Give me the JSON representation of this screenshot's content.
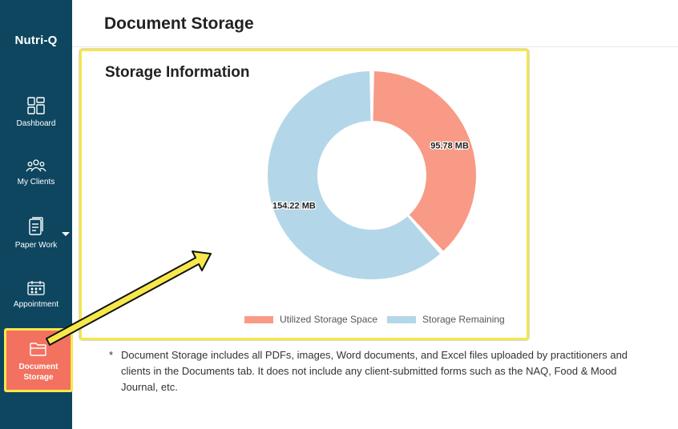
{
  "app": {
    "brand": "Nutri-Q"
  },
  "sidebar": {
    "items": [
      {
        "label": "Dashboard",
        "icon": "dashboard-icon"
      },
      {
        "label": "My Clients",
        "icon": "clients-icon"
      },
      {
        "label": "Paper Work",
        "icon": "paperwork-icon"
      },
      {
        "label": "Appointment",
        "icon": "calendar-icon"
      },
      {
        "label_line1": "Document",
        "label_line2": "Storage",
        "icon": "folder-icon",
        "active": true
      }
    ]
  },
  "page": {
    "title": "Document Storage"
  },
  "card": {
    "title": "Storage Information"
  },
  "chart_data": {
    "type": "pie",
    "donut": true,
    "series": [
      {
        "name": "Utilized Storage Space",
        "value": 95.78,
        "label": "95.78 MB",
        "color": "#f99a86"
      },
      {
        "name": "Storage Remaining",
        "value": 154.22,
        "label": "154.22 MB",
        "color": "#b3d7e8"
      }
    ],
    "legend_position": "bottom"
  },
  "footnote": {
    "marker": "*",
    "text": "Document Storage includes all PDFs, images, Word documents, and Excel files uploaded by practitioners and clients in the Documents tab. It does not include any client-submitted forms such as the NAQ, Food & Mood Journal, etc."
  },
  "colors": {
    "sidebar": "#0e4660",
    "active": "#f2725f",
    "highlight": "#f4e64a"
  }
}
